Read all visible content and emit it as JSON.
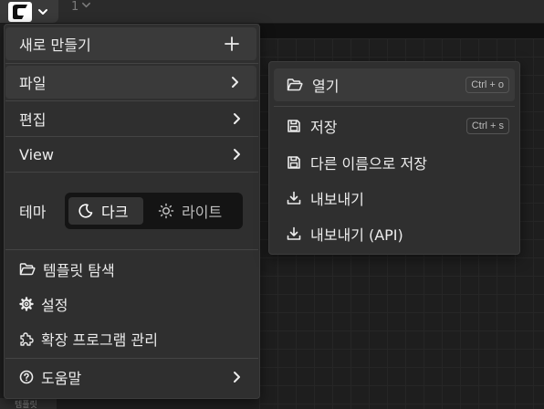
{
  "topbar": {
    "workflow_tab_label": "1",
    "bottom_stub_label": "템플릿"
  },
  "main_menu": {
    "new": "새로 만들기",
    "file": "파일",
    "edit": "편집",
    "view": "View",
    "theme_label": "테마",
    "theme_dark": "다크",
    "theme_light": "라이트",
    "browse_templates": "템플릿 탐색",
    "settings": "설정",
    "manage_extensions": "확장 프로그램 관리",
    "help": "도움말"
  },
  "file_submenu": {
    "open": "열기",
    "open_shortcut": "Ctrl + o",
    "save": "저장",
    "save_shortcut": "Ctrl + s",
    "save_as": "다른 이름으로 저장",
    "export": "내보내기",
    "export_api": "내보내기 (API)"
  },
  "icons": {
    "logo": "app-logo-icon",
    "plus": "plus-icon",
    "chevron_right": "chevron-right-icon",
    "moon": "moon-icon",
    "sun": "sun-icon",
    "folder": "folder-open-icon",
    "gear": "gear-icon",
    "puzzle": "puzzle-icon",
    "help": "help-circle-icon",
    "save": "save-icon",
    "download": "download-icon"
  }
}
